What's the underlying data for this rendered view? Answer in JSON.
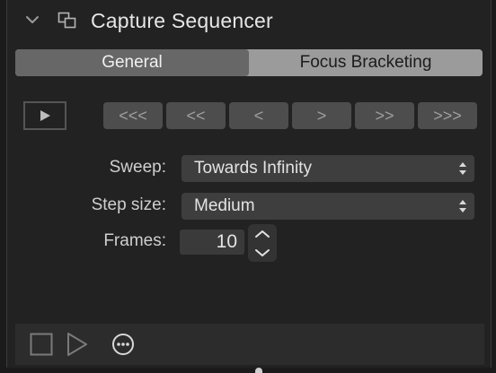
{
  "header": {
    "title": "Capture Sequencer",
    "collapse_icon": "chevron-down-icon",
    "panel_icon": "layers-icon"
  },
  "tabs": [
    {
      "label": "General",
      "active": true
    },
    {
      "label": "Focus Bracketing",
      "active": false
    }
  ],
  "playback": {
    "play_icon": "play-icon",
    "step_buttons": [
      "<<<",
      "<<",
      "<",
      ">",
      ">>",
      ">>>"
    ]
  },
  "settings": {
    "sweep": {
      "label": "Sweep:",
      "value": "Towards Infinity"
    },
    "step_size": {
      "label": "Step size:",
      "value": "Medium"
    },
    "frames": {
      "label": "Frames:",
      "value": "10"
    }
  },
  "footer": {
    "icons": [
      "stop-icon",
      "play-icon",
      "more-icon"
    ]
  },
  "colors": {
    "panel_bg": "#222222",
    "tab_active": "#676767",
    "tab_inactive": "#9b9b9b",
    "button_bg": "#4d4d4d",
    "text": "#e6e6e6"
  }
}
